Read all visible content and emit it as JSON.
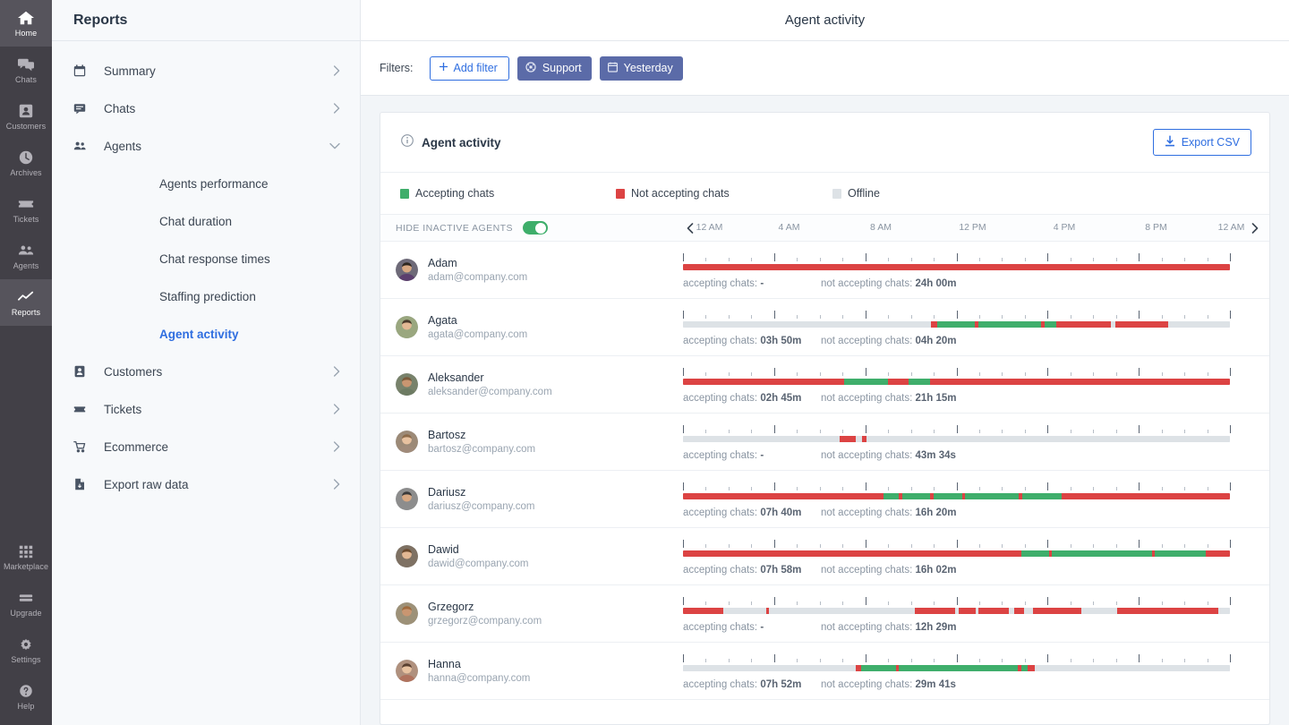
{
  "rail": {
    "top_items": [
      {
        "label": "Home",
        "icon": "home-icon",
        "active": true
      },
      {
        "label": "Chats",
        "icon": "chats-icon",
        "active": false
      },
      {
        "label": "Customers",
        "icon": "customers-icon",
        "active": false
      },
      {
        "label": "Archives",
        "icon": "archives-icon",
        "active": false
      },
      {
        "label": "Tickets",
        "icon": "tickets-icon",
        "active": false
      },
      {
        "label": "Agents",
        "icon": "agents-icon",
        "active": false
      },
      {
        "label": "Reports",
        "icon": "reports-icon",
        "active": true
      }
    ],
    "bottom_items": [
      {
        "label": "Marketplace",
        "icon": "marketplace-icon"
      },
      {
        "label": "Upgrade",
        "icon": "upgrade-icon"
      },
      {
        "label": "Settings",
        "icon": "gear-icon"
      },
      {
        "label": "Help",
        "icon": "help-icon"
      }
    ]
  },
  "sidebar": {
    "title": "Reports",
    "items": [
      {
        "label": "Summary",
        "icon": "calendar-icon",
        "expandable": true,
        "expanded": false
      },
      {
        "label": "Chats",
        "icon": "chat-bubble-icon",
        "expandable": true,
        "expanded": false
      },
      {
        "label": "Agents",
        "icon": "agents-icon",
        "expandable": true,
        "expanded": true
      },
      {
        "label": "Customers",
        "icon": "customer-card-icon",
        "expandable": true,
        "expanded": false
      },
      {
        "label": "Tickets",
        "icon": "ticket-icon",
        "expandable": true,
        "expanded": false
      },
      {
        "label": "Ecommerce",
        "icon": "cart-icon",
        "expandable": true,
        "expanded": false
      },
      {
        "label": "Export raw data",
        "icon": "file-icon",
        "expandable": true,
        "expanded": false
      }
    ],
    "agents_subitems": [
      {
        "label": "Agents performance",
        "selected": false
      },
      {
        "label": "Chat duration",
        "selected": false
      },
      {
        "label": "Chat response times",
        "selected": false
      },
      {
        "label": "Staffing prediction",
        "selected": false
      },
      {
        "label": "Agent activity",
        "selected": true
      }
    ]
  },
  "header": {
    "title": "Agent activity"
  },
  "filters": {
    "label": "Filters:",
    "add_filter_label": "Add filter",
    "chips": [
      {
        "label": "Support",
        "icon": "headset-icon"
      },
      {
        "label": "Yesterday",
        "icon": "calendar-icon"
      }
    ]
  },
  "card": {
    "title": "Agent activity",
    "info_icon": "info-icon",
    "export_label": "Export CSV",
    "export_icon": "download-icon"
  },
  "legend": [
    {
      "label": "Accepting chats",
      "color": "#3fae6b"
    },
    {
      "label": "Not accepting chats",
      "color": "#dc4343"
    },
    {
      "label": "Offline",
      "color": "#dde2e6"
    }
  ],
  "toolbar": {
    "hide_inactive_label": "HIDE INACTIVE AGENTS",
    "hide_inactive_on": true,
    "prev_icon": "chevron-left-icon",
    "next_icon": "chevron-right-icon"
  },
  "stat_labels": {
    "accepting_prefix": "accepting chats:",
    "not_accepting_prefix": "not accepting chats:"
  },
  "chart_data": {
    "type": "timeline",
    "title": "Agent activity",
    "axis_ticks": [
      "12 AM",
      "4 AM",
      "8 AM",
      "12 PM",
      "4 PM",
      "8 PM",
      "12 AM"
    ],
    "axis_range_hours": [
      0,
      24
    ],
    "major_tick_every_hours": 4,
    "minor_tick_every_hours": 1,
    "status_colors": {
      "accepting": "#3fae6b",
      "not_accepting": "#dc4343",
      "offline": "#dde2e6"
    },
    "series": [
      {
        "name": "Adam",
        "email": "adam@company.com",
        "avatar_color": "#5c3f6e",
        "accepting_total": "-",
        "not_accepting_total": "24h 00m",
        "segments": [
          {
            "status": "not_accepting",
            "start_pct": 0,
            "end_pct": 100
          }
        ]
      },
      {
        "name": "Agata",
        "email": "agata@company.com",
        "avatar_color": "#9aa77f",
        "accepting_total": "03h 50m",
        "not_accepting_total": "04h 20m",
        "segments": [
          {
            "status": "offline",
            "start_pct": 0,
            "end_pct": 45.3
          },
          {
            "status": "not_accepting",
            "start_pct": 45.3,
            "end_pct": 46.4
          },
          {
            "status": "accepting",
            "start_pct": 46.4,
            "end_pct": 53.4
          },
          {
            "status": "not_accepting",
            "start_pct": 53.4,
            "end_pct": 54.0
          },
          {
            "status": "accepting",
            "start_pct": 54.0,
            "end_pct": 65.4
          },
          {
            "status": "not_accepting",
            "start_pct": 65.4,
            "end_pct": 66.2
          },
          {
            "status": "accepting",
            "start_pct": 66.2,
            "end_pct": 68.3
          },
          {
            "status": "not_accepting",
            "start_pct": 68.3,
            "end_pct": 78.3
          },
          {
            "status": "offline",
            "start_pct": 78.3,
            "end_pct": 79.1
          },
          {
            "status": "not_accepting",
            "start_pct": 79.1,
            "end_pct": 88.7
          },
          {
            "status": "offline",
            "start_pct": 88.7,
            "end_pct": 100
          }
        ]
      },
      {
        "name": "Aleksander",
        "email": "aleksander@company.com",
        "avatar_color": "#6d7b63",
        "accepting_total": "02h 45m",
        "not_accepting_total": "21h 15m",
        "segments": [
          {
            "status": "not_accepting",
            "start_pct": 0,
            "end_pct": 29.5
          },
          {
            "status": "accepting",
            "start_pct": 29.5,
            "end_pct": 37.4
          },
          {
            "status": "not_accepting",
            "start_pct": 37.4,
            "end_pct": 41.2
          },
          {
            "status": "accepting",
            "start_pct": 41.2,
            "end_pct": 45.2
          },
          {
            "status": "not_accepting",
            "start_pct": 45.2,
            "end_pct": 100
          }
        ]
      },
      {
        "name": "Bartosz",
        "email": "bartosz@company.com",
        "avatar_color": "#a08b7a",
        "accepting_total": "-",
        "not_accepting_total": "43m 34s",
        "segments": [
          {
            "status": "offline",
            "start_pct": 0,
            "end_pct": 28.6
          },
          {
            "status": "not_accepting",
            "start_pct": 28.6,
            "end_pct": 31.6
          },
          {
            "status": "offline",
            "start_pct": 31.6,
            "end_pct": 32.8
          },
          {
            "status": "not_accepting",
            "start_pct": 32.8,
            "end_pct": 33.6
          },
          {
            "status": "offline",
            "start_pct": 33.6,
            "end_pct": 100
          }
        ]
      },
      {
        "name": "Dariusz",
        "email": "dariusz@company.com",
        "avatar_color": "#8d8d8d",
        "accepting_total": "07h 40m",
        "not_accepting_total": "16h 20m",
        "segments": [
          {
            "status": "not_accepting",
            "start_pct": 0,
            "end_pct": 36.6
          },
          {
            "status": "accepting",
            "start_pct": 36.6,
            "end_pct": 39.5
          },
          {
            "status": "not_accepting",
            "start_pct": 39.5,
            "end_pct": 40.1
          },
          {
            "status": "accepting",
            "start_pct": 40.1,
            "end_pct": 45.2
          },
          {
            "status": "not_accepting",
            "start_pct": 45.2,
            "end_pct": 45.8
          },
          {
            "status": "accepting",
            "start_pct": 45.8,
            "end_pct": 51.0
          },
          {
            "status": "not_accepting",
            "start_pct": 51.0,
            "end_pct": 51.6
          },
          {
            "status": "accepting",
            "start_pct": 51.6,
            "end_pct": 61.4
          },
          {
            "status": "not_accepting",
            "start_pct": 61.4,
            "end_pct": 62.0
          },
          {
            "status": "accepting",
            "start_pct": 62.0,
            "end_pct": 69.2
          },
          {
            "status": "not_accepting",
            "start_pct": 69.2,
            "end_pct": 100
          }
        ]
      },
      {
        "name": "Dawid",
        "email": "dawid@company.com",
        "avatar_color": "#7e7163",
        "accepting_total": "07h 58m",
        "not_accepting_total": "16h 02m",
        "segments": [
          {
            "status": "not_accepting",
            "start_pct": 0,
            "end_pct": 61.8
          },
          {
            "status": "accepting",
            "start_pct": 61.8,
            "end_pct": 67.0
          },
          {
            "status": "not_accepting",
            "start_pct": 67.0,
            "end_pct": 67.5
          },
          {
            "status": "accepting",
            "start_pct": 67.5,
            "end_pct": 85.8
          },
          {
            "status": "not_accepting",
            "start_pct": 85.8,
            "end_pct": 86.3
          },
          {
            "status": "accepting",
            "start_pct": 86.3,
            "end_pct": 95.6
          },
          {
            "status": "not_accepting",
            "start_pct": 95.6,
            "end_pct": 100
          }
        ]
      },
      {
        "name": "Grzegorz",
        "email": "grzegorz@company.com",
        "avatar_color": "#9d9178",
        "accepting_total": "-",
        "not_accepting_total": "12h 29m",
        "segments": [
          {
            "status": "not_accepting",
            "start_pct": 0,
            "end_pct": 7.4
          },
          {
            "status": "offline",
            "start_pct": 7.4,
            "end_pct": 15.3
          },
          {
            "status": "not_accepting",
            "start_pct": 15.3,
            "end_pct": 15.7
          },
          {
            "status": "offline",
            "start_pct": 15.7,
            "end_pct": 42.4
          },
          {
            "status": "not_accepting",
            "start_pct": 42.4,
            "end_pct": 49.8
          },
          {
            "status": "offline",
            "start_pct": 49.8,
            "end_pct": 50.4
          },
          {
            "status": "not_accepting",
            "start_pct": 50.4,
            "end_pct": 53.6
          },
          {
            "status": "offline",
            "start_pct": 53.6,
            "end_pct": 54.0
          },
          {
            "status": "not_accepting",
            "start_pct": 54.0,
            "end_pct": 59.6
          },
          {
            "status": "offline",
            "start_pct": 59.6,
            "end_pct": 60.5
          },
          {
            "status": "not_accepting",
            "start_pct": 60.5,
            "end_pct": 62.4
          },
          {
            "status": "offline",
            "start_pct": 62.4,
            "end_pct": 64.0
          },
          {
            "status": "not_accepting",
            "start_pct": 64.0,
            "end_pct": 72.8
          },
          {
            "status": "offline",
            "start_pct": 72.8,
            "end_pct": 79.4
          },
          {
            "status": "not_accepting",
            "start_pct": 79.4,
            "end_pct": 97.8
          },
          {
            "status": "offline",
            "start_pct": 97.8,
            "end_pct": 100
          }
        ]
      },
      {
        "name": "Hanna",
        "email": "hanna@company.com",
        "avatar_color": "#b0735e",
        "accepting_total": "07h 52m",
        "not_accepting_total": "29m 41s",
        "segments": [
          {
            "status": "offline",
            "start_pct": 0,
            "end_pct": 31.6
          },
          {
            "status": "not_accepting",
            "start_pct": 31.6,
            "end_pct": 32.6
          },
          {
            "status": "accepting",
            "start_pct": 32.6,
            "end_pct": 39.0
          },
          {
            "status": "not_accepting",
            "start_pct": 39.0,
            "end_pct": 39.4
          },
          {
            "status": "accepting",
            "start_pct": 39.4,
            "end_pct": 61.2
          },
          {
            "status": "not_accepting",
            "start_pct": 61.2,
            "end_pct": 61.8
          },
          {
            "status": "accepting",
            "start_pct": 61.8,
            "end_pct": 63.0
          },
          {
            "status": "not_accepting",
            "start_pct": 63.0,
            "end_pct": 64.4
          },
          {
            "status": "offline",
            "start_pct": 64.4,
            "end_pct": 100
          }
        ]
      }
    ]
  }
}
